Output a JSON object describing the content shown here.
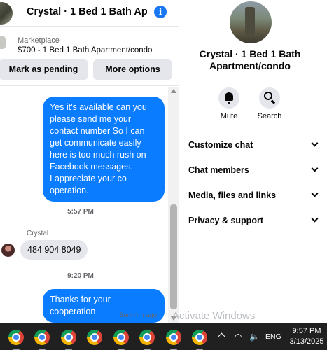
{
  "chat_header": {
    "title": "Crystal · 1 Bed 1 Bath Ap…",
    "info_icon": "info-icon"
  },
  "listing": {
    "source": "Marketplace",
    "title": "$700 - 1 Bed 1 Bath Apartment/condo",
    "buttons": [
      "Mark as pending",
      "More options"
    ]
  },
  "messages": {
    "outgoing_long": "Yes it's available can you please send me your contact number So I can get communicate easily here is too much rush on Facebook messages.\nI appreciate your co operation.",
    "time_1": "5:57 PM",
    "sender_name": "Crystal",
    "incoming": "484 904 8049",
    "time_2": "9:20 PM",
    "outgoing_thanks": "Thanks for your cooperation",
    "seen": "Sent 4m ago"
  },
  "details": {
    "name": "Crystal · 1 Bed 1 Bath Apartment/condo",
    "actions": [
      {
        "label": "Mute",
        "icon": "bell-icon"
      },
      {
        "label": "Search",
        "icon": "search-icon"
      }
    ],
    "sections": [
      "Customize chat",
      "Chat members",
      "Media, files and links",
      "Privacy & support"
    ]
  },
  "watermark": "Activate Windows",
  "taskbar": {
    "apps": [
      "chrome-icon",
      "chrome-icon",
      "chrome-icon",
      "chrome-icon",
      "chrome-icon",
      "chrome-icon",
      "chrome-icon",
      "chrome-icon"
    ],
    "language": "ENG",
    "time": "9:57 PM",
    "date": "3/13/2025"
  },
  "colors": {
    "accent": "#0a7cff",
    "button_bg": "#e4e6eb",
    "taskbar": "#202020"
  }
}
